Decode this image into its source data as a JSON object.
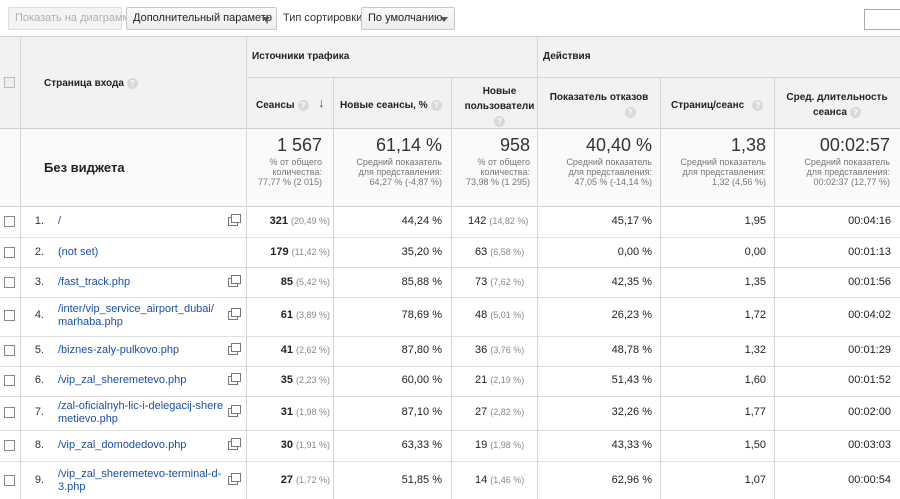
{
  "toolbar": {
    "show_on_chart": "Показать на диаграмме",
    "secondary_dimension": "Дополнительный параметр",
    "sort_type_label": "Тип сортировки:",
    "sort_type_value": "По умолчанию"
  },
  "groups": {
    "traffic": "Источники трафика",
    "actions": "Действия"
  },
  "columns": {
    "landing": "Страница входа",
    "sessions": "Сеансы",
    "new_sessions": "Новые сеансы, %",
    "new_users_1": "Новые",
    "new_users_2": "пользователи",
    "bounce": "Показатель отказов",
    "pages": "Страниц/сеанс",
    "duration_1": "Сред. длительность",
    "duration_2": "сеанса"
  },
  "totals": {
    "label": "Без виджета",
    "sessions": "1 567",
    "sessions_s1": "% от общего",
    "sessions_s2": "количества:",
    "sessions_s3": "77,77 % (2 015)",
    "new_sessions": "61,14 %",
    "new_sessions_s1": "Средний показатель",
    "new_sessions_s2": "для представления:",
    "new_sessions_s3": "64,27 % (-4,87 %)",
    "new_users": "958",
    "new_users_s1": "% от общего",
    "new_users_s2": "количества:",
    "new_users_s3": "73,98 % (1 295)",
    "bounce": "40,40 %",
    "bounce_s1": "Средний показатель",
    "bounce_s2": "для представления:",
    "bounce_s3": "47,05 % (-14,14 %)",
    "pages": "1,38",
    "pages_s1": "Средний показатель",
    "pages_s2": "для представления:",
    "pages_s3": "1,32 (4,56 %)",
    "duration": "00:02:57",
    "duration_s1": "Средний показатель",
    "duration_s2": "для представления:",
    "duration_s3": "00:02:37 (12,77 %)"
  },
  "rows": [
    {
      "n": "1.",
      "page1": "/",
      "page2": "",
      "sessions": "321",
      "sessions_pct": "(20,49 %)",
      "new_sessions": "44,24 %",
      "new_users": "142",
      "new_users_pct": "(14,82 %)",
      "bounce": "45,17 %",
      "pages": "1,95",
      "duration": "00:04:16"
    },
    {
      "n": "2.",
      "page1": "(not set)",
      "page2": "",
      "sessions": "179",
      "sessions_pct": "(11,42 %)",
      "new_sessions": "35,20 %",
      "new_users": "63",
      "new_users_pct": "(6,58 %)",
      "bounce": "0,00 %",
      "pages": "0,00",
      "duration": "00:01:13"
    },
    {
      "n": "3.",
      "page1": "/fast_track.php",
      "page2": "",
      "sessions": "85",
      "sessions_pct": "(5,42 %)",
      "new_sessions": "85,88 %",
      "new_users": "73",
      "new_users_pct": "(7,62 %)",
      "bounce": "42,35 %",
      "pages": "1,35",
      "duration": "00:01:56"
    },
    {
      "n": "4.",
      "page1": "/inter/vip_service_airport_dubai/",
      "page2": "marhaba.php",
      "sessions": "61",
      "sessions_pct": "(3,89 %)",
      "new_sessions": "78,69 %",
      "new_users": "48",
      "new_users_pct": "(5,01 %)",
      "bounce": "26,23 %",
      "pages": "1,72",
      "duration": "00:04:02"
    },
    {
      "n": "5.",
      "page1": "/biznes-zaly-pulkovo.php",
      "page2": "",
      "sessions": "41",
      "sessions_pct": "(2,62 %)",
      "new_sessions": "87,80 %",
      "new_users": "36",
      "new_users_pct": "(3,76 %)",
      "bounce": "48,78 %",
      "pages": "1,32",
      "duration": "00:01:29"
    },
    {
      "n": "6.",
      "page1": "/vip_zal_sheremetevo.php",
      "page2": "",
      "sessions": "35",
      "sessions_pct": "(2,23 %)",
      "new_sessions": "60,00 %",
      "new_users": "21",
      "new_users_pct": "(2,19 %)",
      "bounce": "51,43 %",
      "pages": "1,60",
      "duration": "00:01:52"
    },
    {
      "n": "7.",
      "page1": "/zal-oficialnyh-lic-i-delegacij-shere",
      "page2": "metievo.php",
      "sessions": "31",
      "sessions_pct": "(1,98 %)",
      "new_sessions": "87,10 %",
      "new_users": "27",
      "new_users_pct": "(2,82 %)",
      "bounce": "32,26 %",
      "pages": "1,77",
      "duration": "00:02:00"
    },
    {
      "n": "8.",
      "page1": "/vip_zal_domodedovo.php",
      "page2": "",
      "sessions": "30",
      "sessions_pct": "(1,91 %)",
      "new_sessions": "63,33 %",
      "new_users": "19",
      "new_users_pct": "(1,98 %)",
      "bounce": "43,33 %",
      "pages": "1,50",
      "duration": "00:03:03"
    },
    {
      "n": "9.",
      "page1": "/vip_zal_sheremetevo-terminal-d-",
      "page2": "3.php",
      "sessions": "27",
      "sessions_pct": "(1,72 %)",
      "new_sessions": "51,85 %",
      "new_users": "14",
      "new_users_pct": "(1,46 %)",
      "bounce": "62,96 %",
      "pages": "1,07",
      "duration": "00:00:54"
    }
  ]
}
